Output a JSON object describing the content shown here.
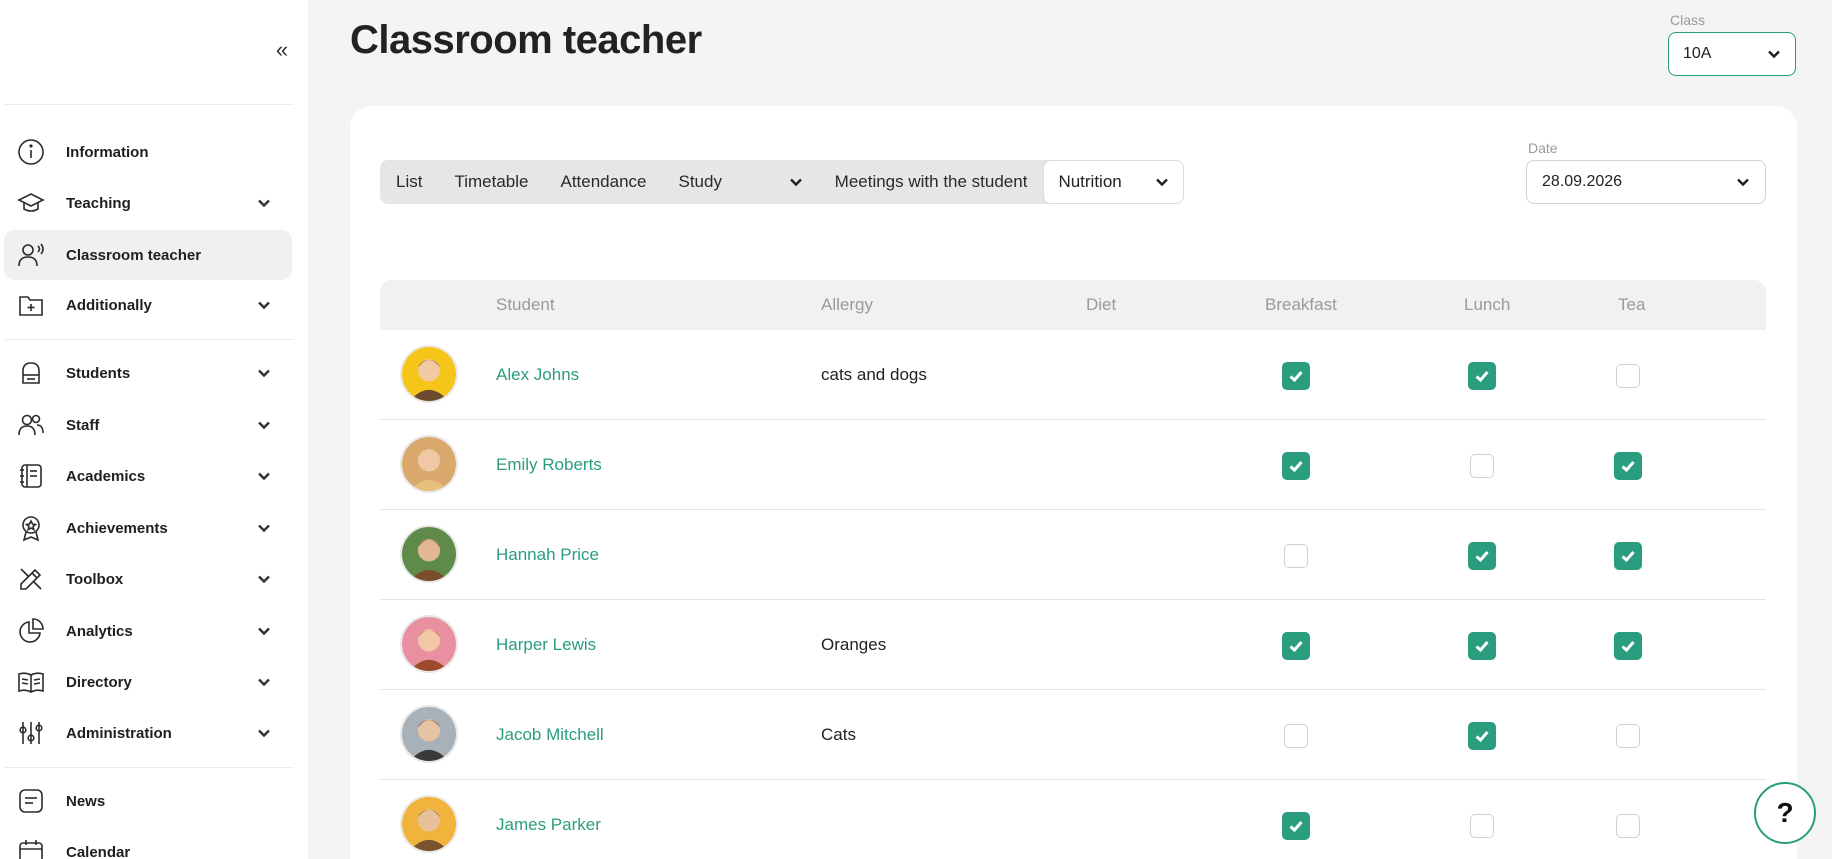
{
  "page": {
    "title": "Classroom teacher"
  },
  "class_select": {
    "label": "Class",
    "value": "10A"
  },
  "sidebar": {
    "items": [
      {
        "label": "Information",
        "icon": "info-icon",
        "expandable": false,
        "active": false
      },
      {
        "label": "Teaching",
        "icon": "graduation-cap-icon",
        "expandable": true,
        "active": false
      },
      {
        "label": "Classroom teacher",
        "icon": "teacher-icon",
        "expandable": false,
        "active": true
      },
      {
        "label": "Additionally",
        "icon": "folder-plus-icon",
        "expandable": true,
        "active": false
      },
      {
        "label": "Students",
        "icon": "backpack-icon",
        "expandable": true,
        "active": false
      },
      {
        "label": "Staff",
        "icon": "users-icon",
        "expandable": true,
        "active": false
      },
      {
        "label": "Academics",
        "icon": "notebook-icon",
        "expandable": true,
        "active": false
      },
      {
        "label": "Achievements",
        "icon": "award-icon",
        "expandable": true,
        "active": false
      },
      {
        "label": "Toolbox",
        "icon": "tools-icon",
        "expandable": true,
        "active": false
      },
      {
        "label": "Analytics",
        "icon": "pie-chart-icon",
        "expandable": true,
        "active": false
      },
      {
        "label": "Directory",
        "icon": "book-icon",
        "expandable": true,
        "active": false
      },
      {
        "label": "Administration",
        "icon": "sliders-icon",
        "expandable": true,
        "active": false
      },
      {
        "label": "News",
        "icon": "news-icon",
        "expandable": false,
        "active": false
      },
      {
        "label": "Calendar",
        "icon": "calendar-icon",
        "expandable": false,
        "active": false
      }
    ]
  },
  "tabs": {
    "list": "List",
    "timetable": "Timetable",
    "attendance": "Attendance",
    "study": "Study",
    "meetings": "Meetings with the student",
    "nutrition": "Nutrition"
  },
  "date_select": {
    "label": "Date",
    "value": "28.09.2026"
  },
  "table": {
    "headers": {
      "student": "Student",
      "allergy": "Allergy",
      "diet": "Diet",
      "breakfast": "Breakfast",
      "lunch": "Lunch",
      "tea": "Tea"
    },
    "rows": [
      {
        "name": "Alex Johns",
        "allergy": "cats and dogs",
        "diet": "",
        "breakfast": true,
        "lunch": true,
        "tea": false
      },
      {
        "name": "Emily Roberts",
        "allergy": "",
        "diet": "",
        "breakfast": true,
        "lunch": false,
        "tea": true
      },
      {
        "name": "Hannah Price",
        "allergy": "",
        "diet": "",
        "breakfast": false,
        "lunch": true,
        "tea": true
      },
      {
        "name": "Harper Lewis",
        "allergy": "Oranges",
        "diet": "",
        "breakfast": true,
        "lunch": true,
        "tea": true
      },
      {
        "name": "Jacob Mitchell",
        "allergy": "Cats",
        "diet": "",
        "breakfast": false,
        "lunch": true,
        "tea": false
      },
      {
        "name": "James Parker",
        "allergy": "",
        "diet": "",
        "breakfast": true,
        "lunch": false,
        "tea": false
      }
    ]
  },
  "help": {
    "label": "?"
  },
  "colors": {
    "accent": "#2a9d7f",
    "page_bg": "#f4f4f4",
    "card_bg": "#ffffff"
  }
}
